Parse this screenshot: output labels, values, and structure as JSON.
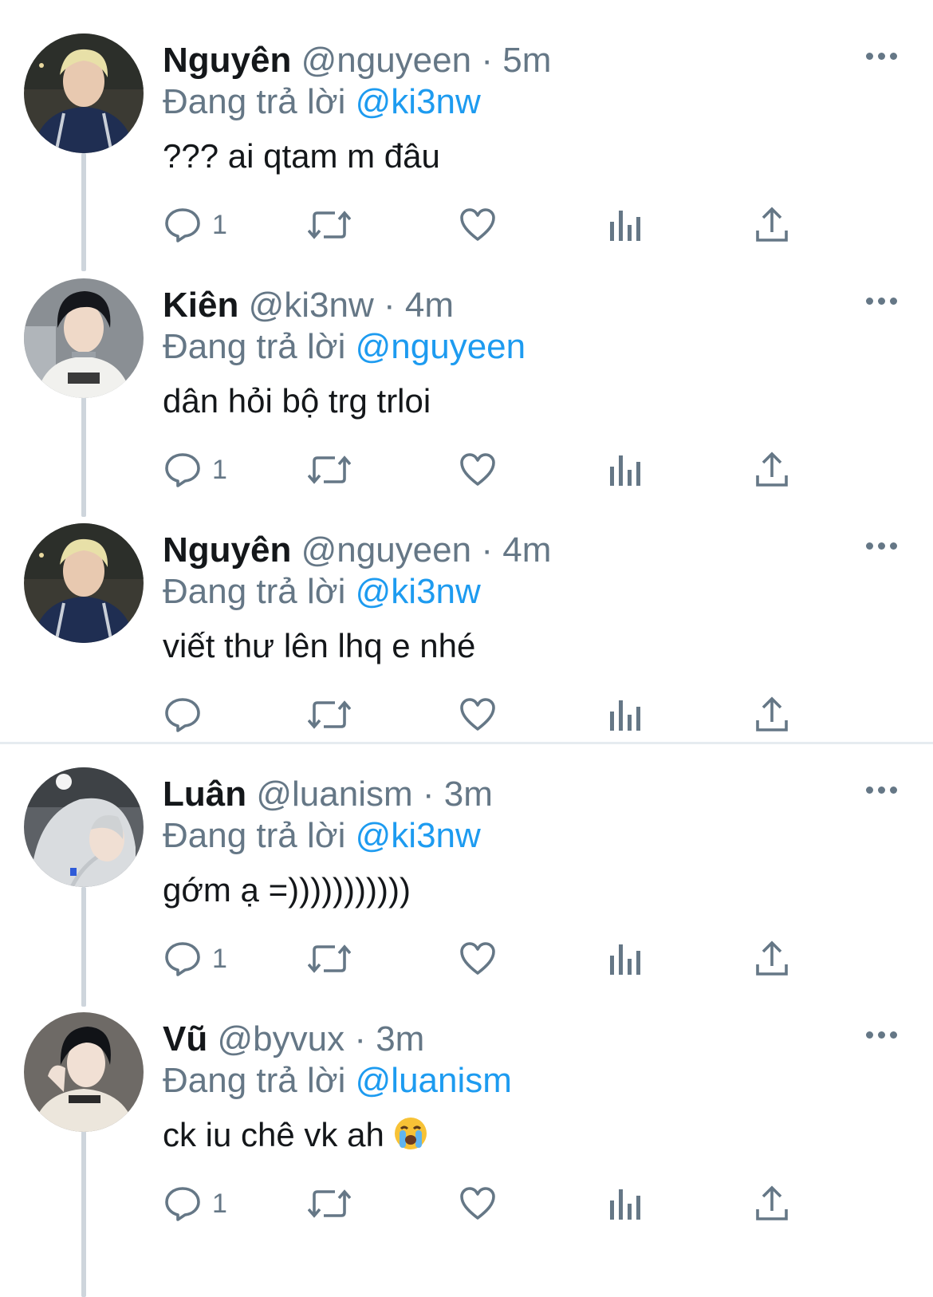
{
  "colors": {
    "accent": "#1d9bf0",
    "muted": "#657786",
    "thread_line": "#ced5dc",
    "text": "#14171a"
  },
  "tweets": [
    {
      "name": "Nguyên",
      "handle": "@nguyeen",
      "sep": "·",
      "time": "5m",
      "reply_prefix": "Đang trả lời",
      "reply_to": "@ki3nw",
      "text": "??? ai qtam m đâu",
      "reply_count": "1",
      "avatar": "avatar-blond-navy-jacket"
    },
    {
      "name": "Kiên",
      "handle": "@ki3nw",
      "sep": "·",
      "time": "4m",
      "reply_prefix": "Đang trả lời",
      "reply_to": "@nguyeen",
      "text": "dân hỏi bộ trg trloi",
      "reply_count": "1",
      "avatar": "avatar-dark-hair-white-hoodie"
    },
    {
      "name": "Nguyên",
      "handle": "@nguyeen",
      "sep": "·",
      "time": "4m",
      "reply_prefix": "Đang trả lời",
      "reply_to": "@ki3nw",
      "text": "viết thư lên lhq e nhé",
      "reply_count": "",
      "avatar": "avatar-blond-navy-jacket"
    },
    {
      "name": "Luân",
      "handle": "@luanism",
      "sep": "·",
      "time": "3m",
      "reply_prefix": "Đang trả lời",
      "reply_to": "@ki3nw",
      "text": "gớm ạ =)))))))))))",
      "reply_count": "1",
      "avatar": "avatar-grey-hoodie"
    },
    {
      "name": "Vũ",
      "handle": "@byvux",
      "sep": "·",
      "time": "3m",
      "reply_prefix": "Đang trả lời",
      "reply_to": "@luanism",
      "text": "ck iu chê vk ah",
      "emoji": "loudly-crying-face-emoji",
      "reply_count": "1",
      "avatar": "avatar-dark-hair-cream-sweater"
    }
  ],
  "icons": [
    "reply-icon",
    "retweet-icon",
    "like-icon",
    "analytics-icon",
    "share-icon",
    "more-icon"
  ]
}
